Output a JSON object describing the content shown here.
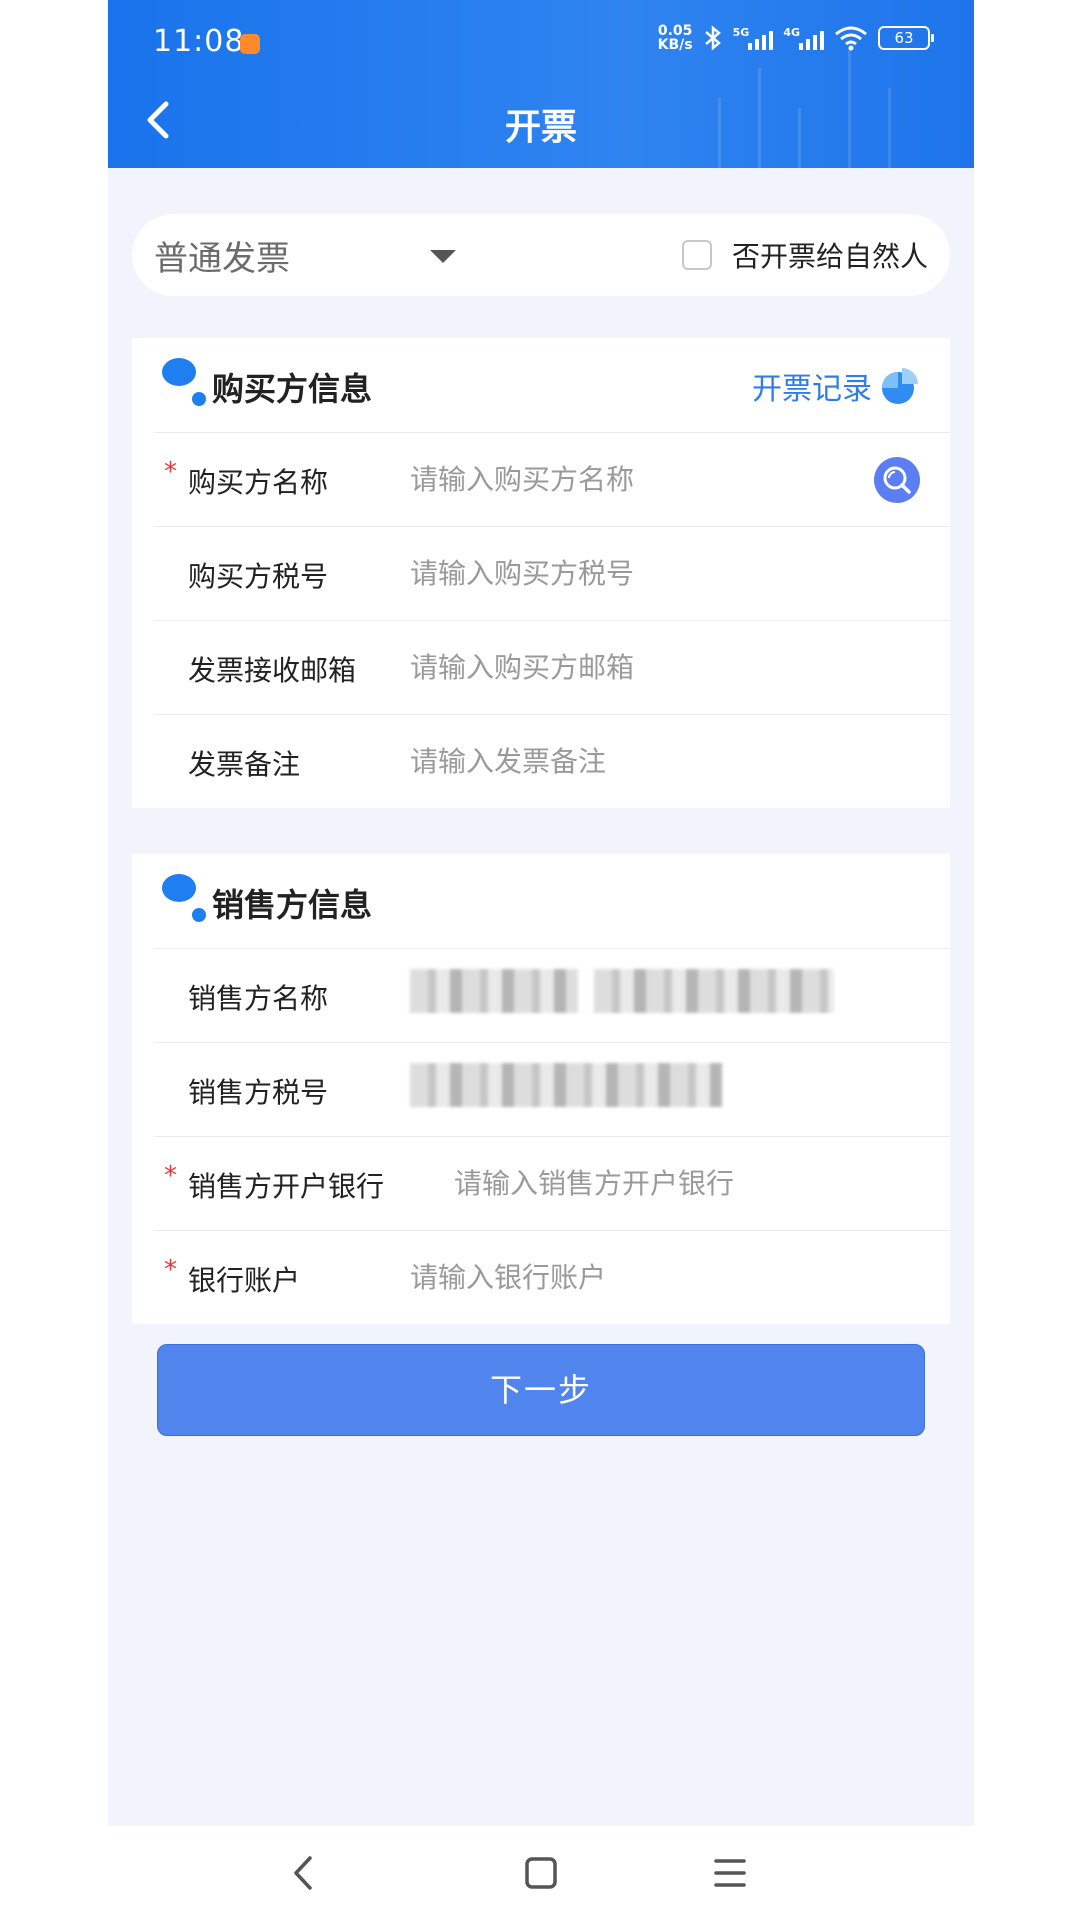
{
  "status_bar": {
    "time": "11:08",
    "net_speed_value": "0.05",
    "net_speed_unit": "KB/s",
    "signal_1_label": "5G",
    "signal_2_label": "4G",
    "battery": "63"
  },
  "header": {
    "title": "开票"
  },
  "invoice_type": {
    "selected": "普通发票",
    "natural_person_label": "否开票给自然人",
    "natural_person_checked": false
  },
  "buyer_section": {
    "title": "购买方信息",
    "record_link": "开票记录",
    "fields": [
      {
        "label": "购买方名称",
        "placeholder": "请输入购买方名称",
        "required": true
      },
      {
        "label": "购买方税号",
        "placeholder": "请输入购买方税号",
        "required": false
      },
      {
        "label": "发票接收邮箱",
        "placeholder": "请输入购买方邮箱",
        "required": false
      },
      {
        "label": "发票备注",
        "placeholder": "请输入发票备注",
        "required": false
      }
    ]
  },
  "seller_section": {
    "title": "销售方信息",
    "fields": [
      {
        "label": "销售方名称",
        "required": false
      },
      {
        "label": "销售方税号",
        "required": false
      },
      {
        "label": "销售方开户银行",
        "placeholder": "请输入销售方开户银行",
        "required": true
      },
      {
        "label": "银行账户",
        "placeholder": "请输入银行账户",
        "required": true
      }
    ]
  },
  "actions": {
    "next_label": "下一步"
  },
  "required_mark": "*",
  "colors": {
    "header_blue": "#1a73ec",
    "accent_blue": "#5085ee",
    "required_red": "#e53935",
    "page_bg": "#f1f4fc"
  }
}
